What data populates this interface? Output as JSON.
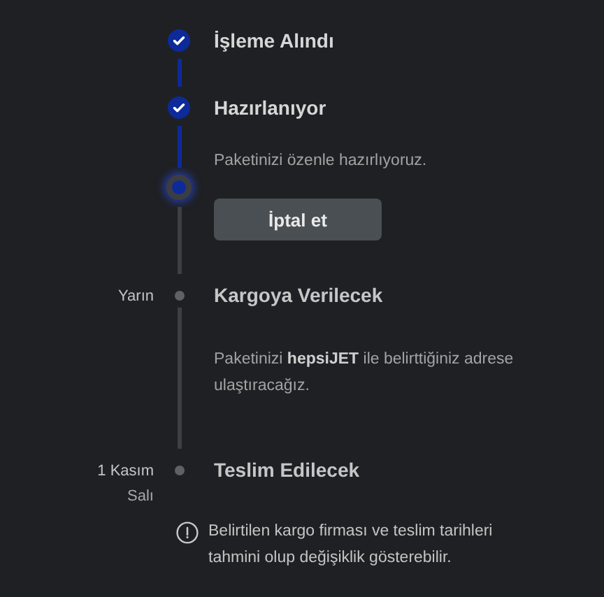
{
  "steps": [
    {
      "kind": "done",
      "title": "İşleme Alındı"
    },
    {
      "kind": "done",
      "title": "Hazırlanıyor",
      "description": "Paketinizi özenle hazırlıyoruz."
    },
    {
      "kind": "current",
      "button": "İptal et"
    },
    {
      "kind": "pending",
      "date": [
        "Yarın"
      ],
      "title": "Kargoya Verilecek",
      "description": "Paketinizi **hepsiJET** ile belirttiğiniz adrese ulaştıracağız."
    },
    {
      "kind": "pending",
      "date": [
        "1 Kasım",
        "Salı"
      ],
      "title": "Teslim Edilecek"
    }
  ],
  "note": "Belirtilen kargo firması ve teslim tarihleri tahmini olup değişiklik gösterebilir."
}
